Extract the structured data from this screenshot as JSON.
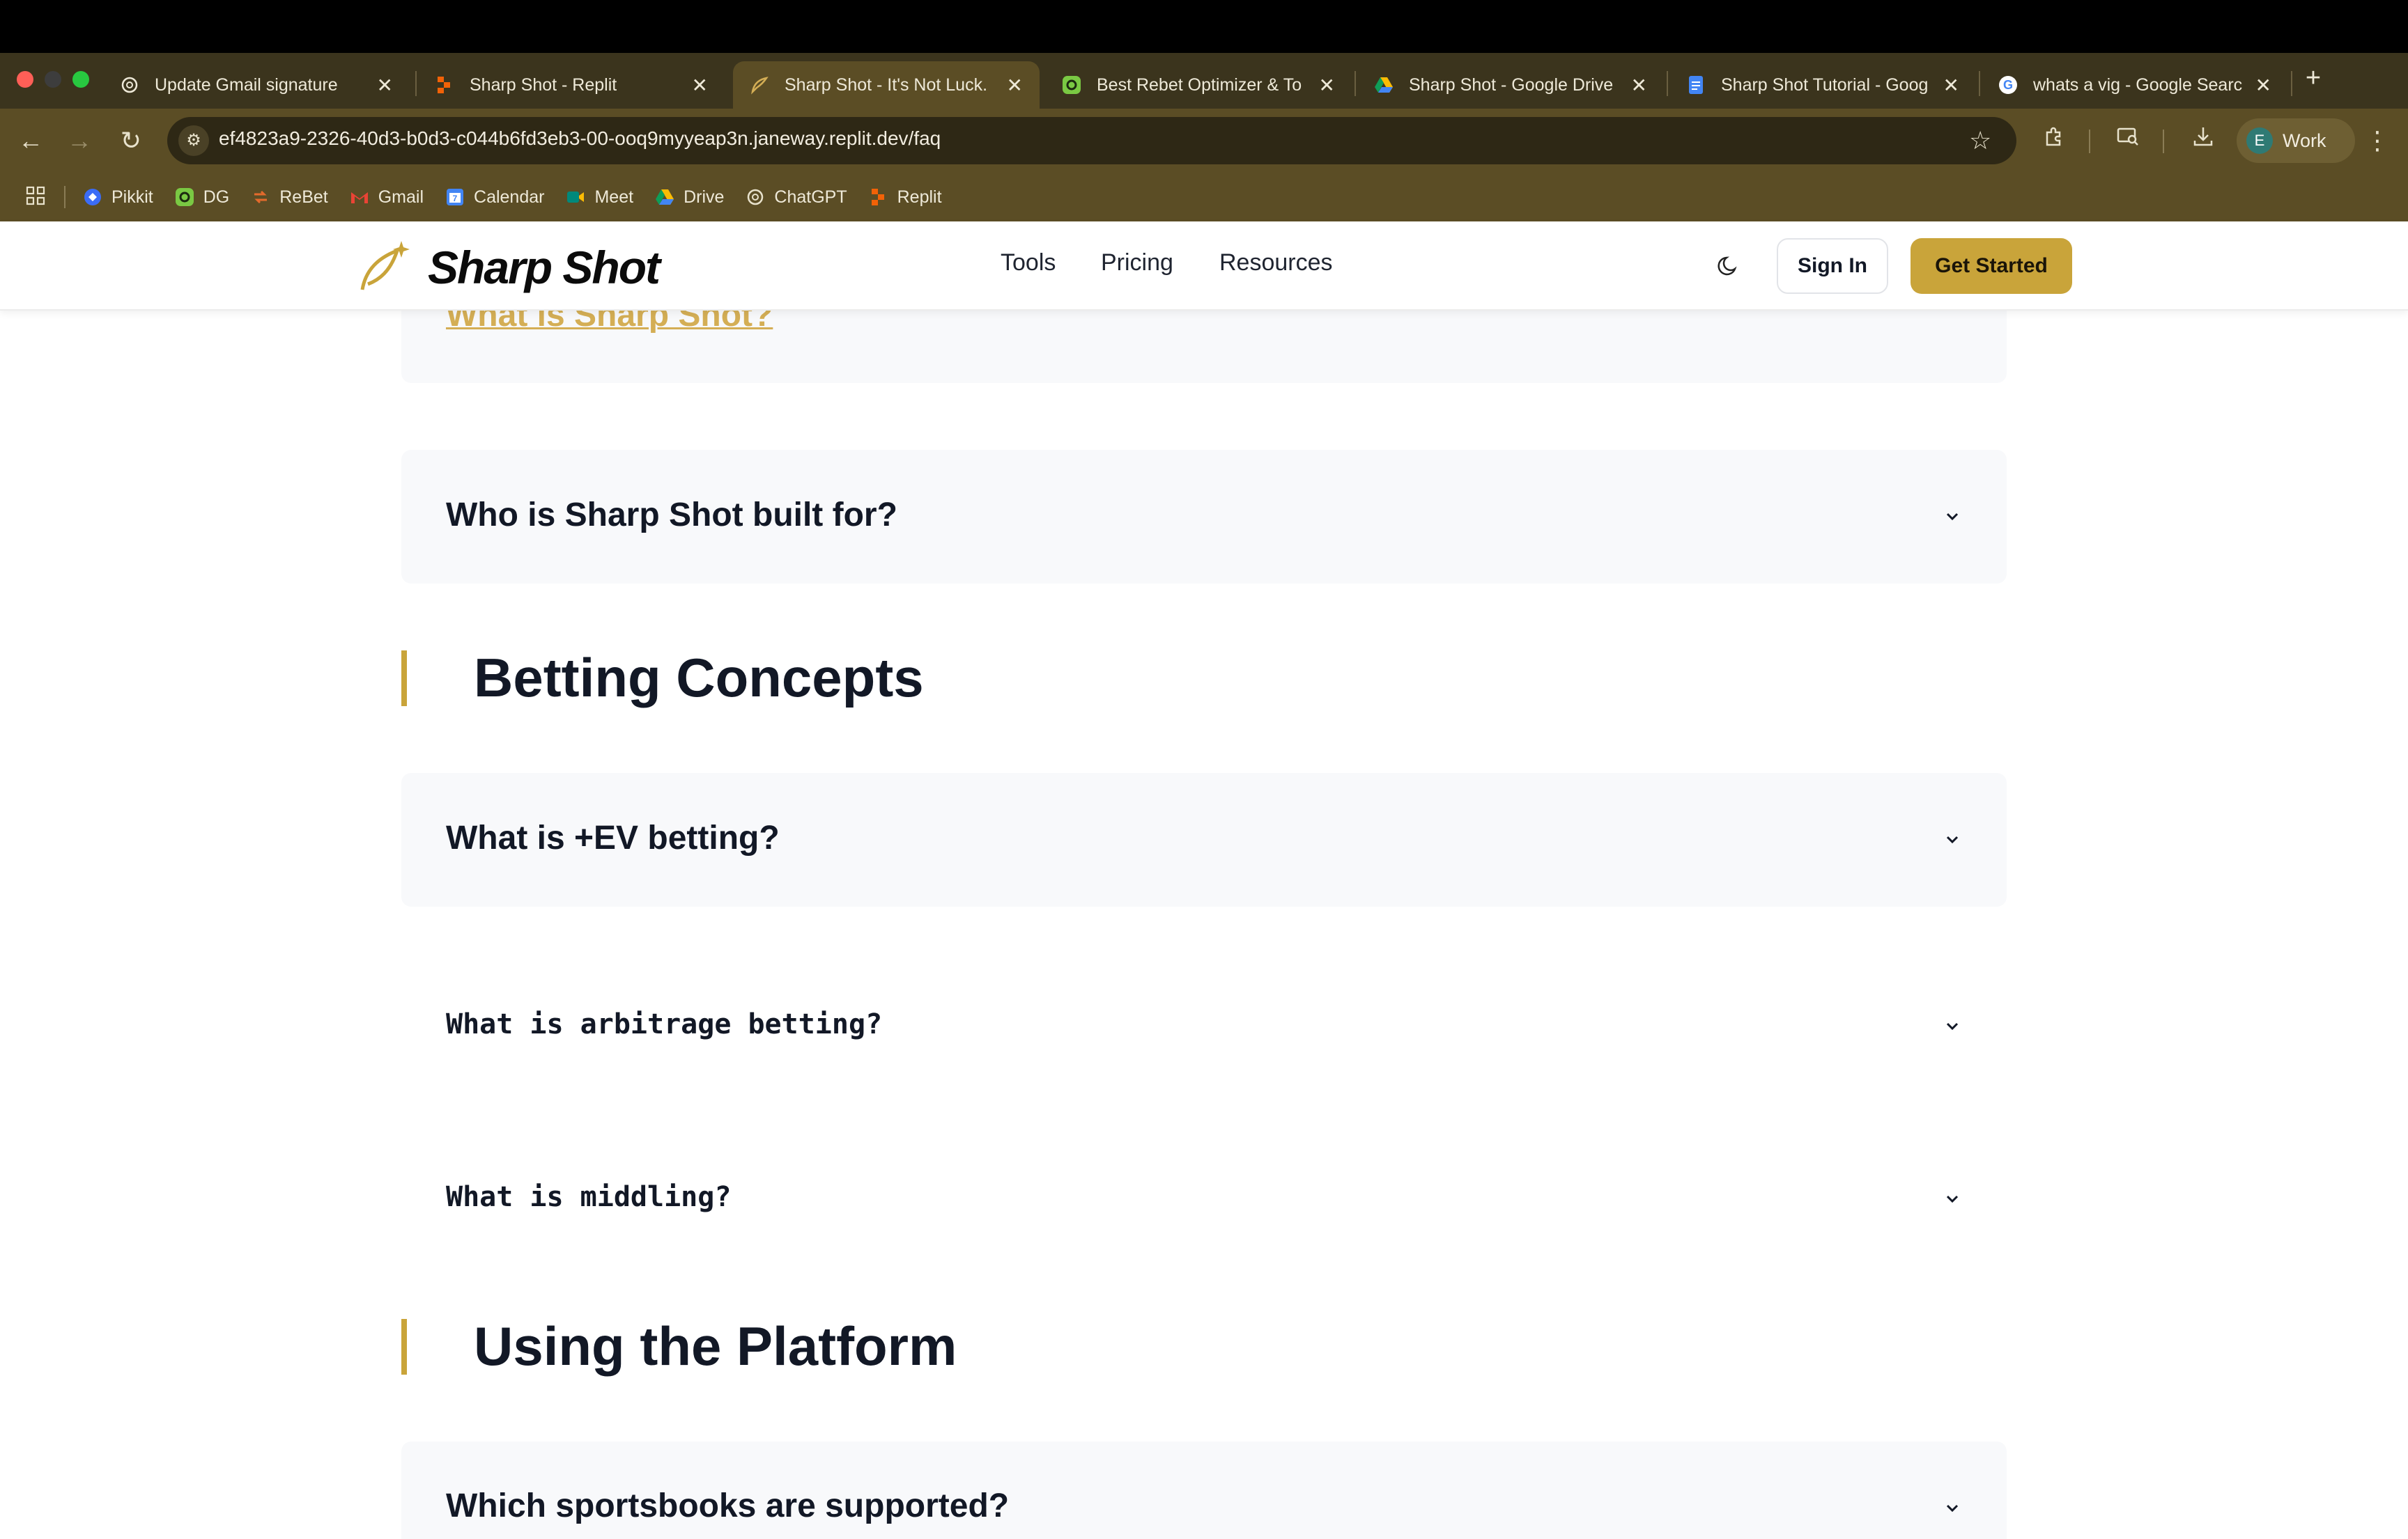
{
  "browser": {
    "tabs": [
      {
        "title": "Update Gmail signature",
        "icon": "openai-icon"
      },
      {
        "title": "Sharp Shot - Replit",
        "icon": "replit-icon"
      },
      {
        "title": "Sharp Shot - It's Not Luck.",
        "icon": "sharpshot-icon",
        "active": true
      },
      {
        "title": "Best Rebet Optimizer & To",
        "icon": "dg-icon"
      },
      {
        "title": "Sharp Shot - Google Drive",
        "icon": "drive-icon"
      },
      {
        "title": "Sharp Shot Tutorial - Goog",
        "icon": "docs-icon"
      },
      {
        "title": "whats a vig - Google Searc",
        "icon": "google-icon"
      }
    ],
    "new_tab": "+",
    "url": "ef4823a9-2326-40d3-b0d3-c044b6fd3eb3-00-ooq9myyeap3n.janeway.replit.dev/faq",
    "profile": {
      "initial": "E",
      "label": "Work"
    },
    "bookmarks": [
      {
        "label": "Pikkit",
        "icon": "pikkit-icon",
        "color": "#3b6cf6"
      },
      {
        "label": "DG",
        "icon": "dg-icon",
        "color": "#7ac943"
      },
      {
        "label": "ReBet",
        "icon": "rebet-icon",
        "color": "#e46a2c"
      },
      {
        "label": "Gmail",
        "icon": "gmail-icon",
        "color": "#ea4335"
      },
      {
        "label": "Calendar",
        "icon": "calendar-icon",
        "color": "#4285f4"
      },
      {
        "label": "Meet",
        "icon": "meet-icon",
        "color": "#00897b"
      },
      {
        "label": "Drive",
        "icon": "drive-icon",
        "color": "#fbbc04"
      },
      {
        "label": "ChatGPT",
        "icon": "openai-icon",
        "color": "#e8e2cc"
      },
      {
        "label": "Replit",
        "icon": "replit-icon",
        "color": "#f26207"
      }
    ]
  },
  "site": {
    "brand": "Sharp Shot",
    "nav": [
      "Tools",
      "Pricing",
      "Resources"
    ],
    "sign_in": "Sign In",
    "get_started": "Get Started",
    "accent": "#c9a43a"
  },
  "faq": {
    "items_top": [
      {
        "question": "What is Sharp Shot?"
      },
      {
        "question": "Who is Sharp Shot built for?"
      }
    ],
    "sections": [
      {
        "title": "Betting Concepts",
        "items": [
          {
            "question": "What is +EV betting?"
          },
          {
            "question": "What is arbitrage betting?"
          },
          {
            "question": "What is middling?"
          }
        ]
      },
      {
        "title": "Using the Platform",
        "items": [
          {
            "question": "Which sportsbooks are supported?"
          }
        ]
      }
    ]
  }
}
